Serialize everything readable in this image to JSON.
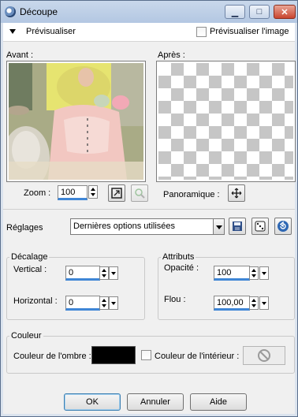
{
  "window": {
    "title": "Découpe"
  },
  "titlebar": {
    "minimize_glyph": "▁",
    "maximize_glyph": "□",
    "close_glyph": "✕"
  },
  "preview": {
    "toggle_label": "Prévisualiser",
    "image_preview_label": "Prévisualiser l'image",
    "image_preview_checked": false
  },
  "panels": {
    "before_label": "Avant :",
    "after_label": "Après :"
  },
  "zoom": {
    "label": "Zoom :",
    "value": "100",
    "pan_label": "Panoramique :"
  },
  "presets": {
    "label": "Réglages",
    "selected": "Dernières options utilisées"
  },
  "offset_group": {
    "title": "Décalage",
    "vertical_label": "Vertical :",
    "vertical_value": "0",
    "horizontal_label": "Horizontal :",
    "horizontal_value": "0"
  },
  "attributes_group": {
    "title": "Attributs",
    "opacity_label": "Opacité :",
    "opacity_value": "100",
    "blur_label": "Flou :",
    "blur_value": "100,00"
  },
  "color_group": {
    "title": "Couleur",
    "shadow_label": "Couleur de l'ombre :",
    "shadow_color": "#000000",
    "inside_label": "Couleur de l'intérieur :",
    "inside_checked": false
  },
  "buttons": {
    "ok": "OK",
    "cancel": "Annuler",
    "help": "Aide"
  },
  "colors": {
    "accent": "#3f86d6",
    "titlebar": "#c1d2e8",
    "close": "#c9452f"
  }
}
